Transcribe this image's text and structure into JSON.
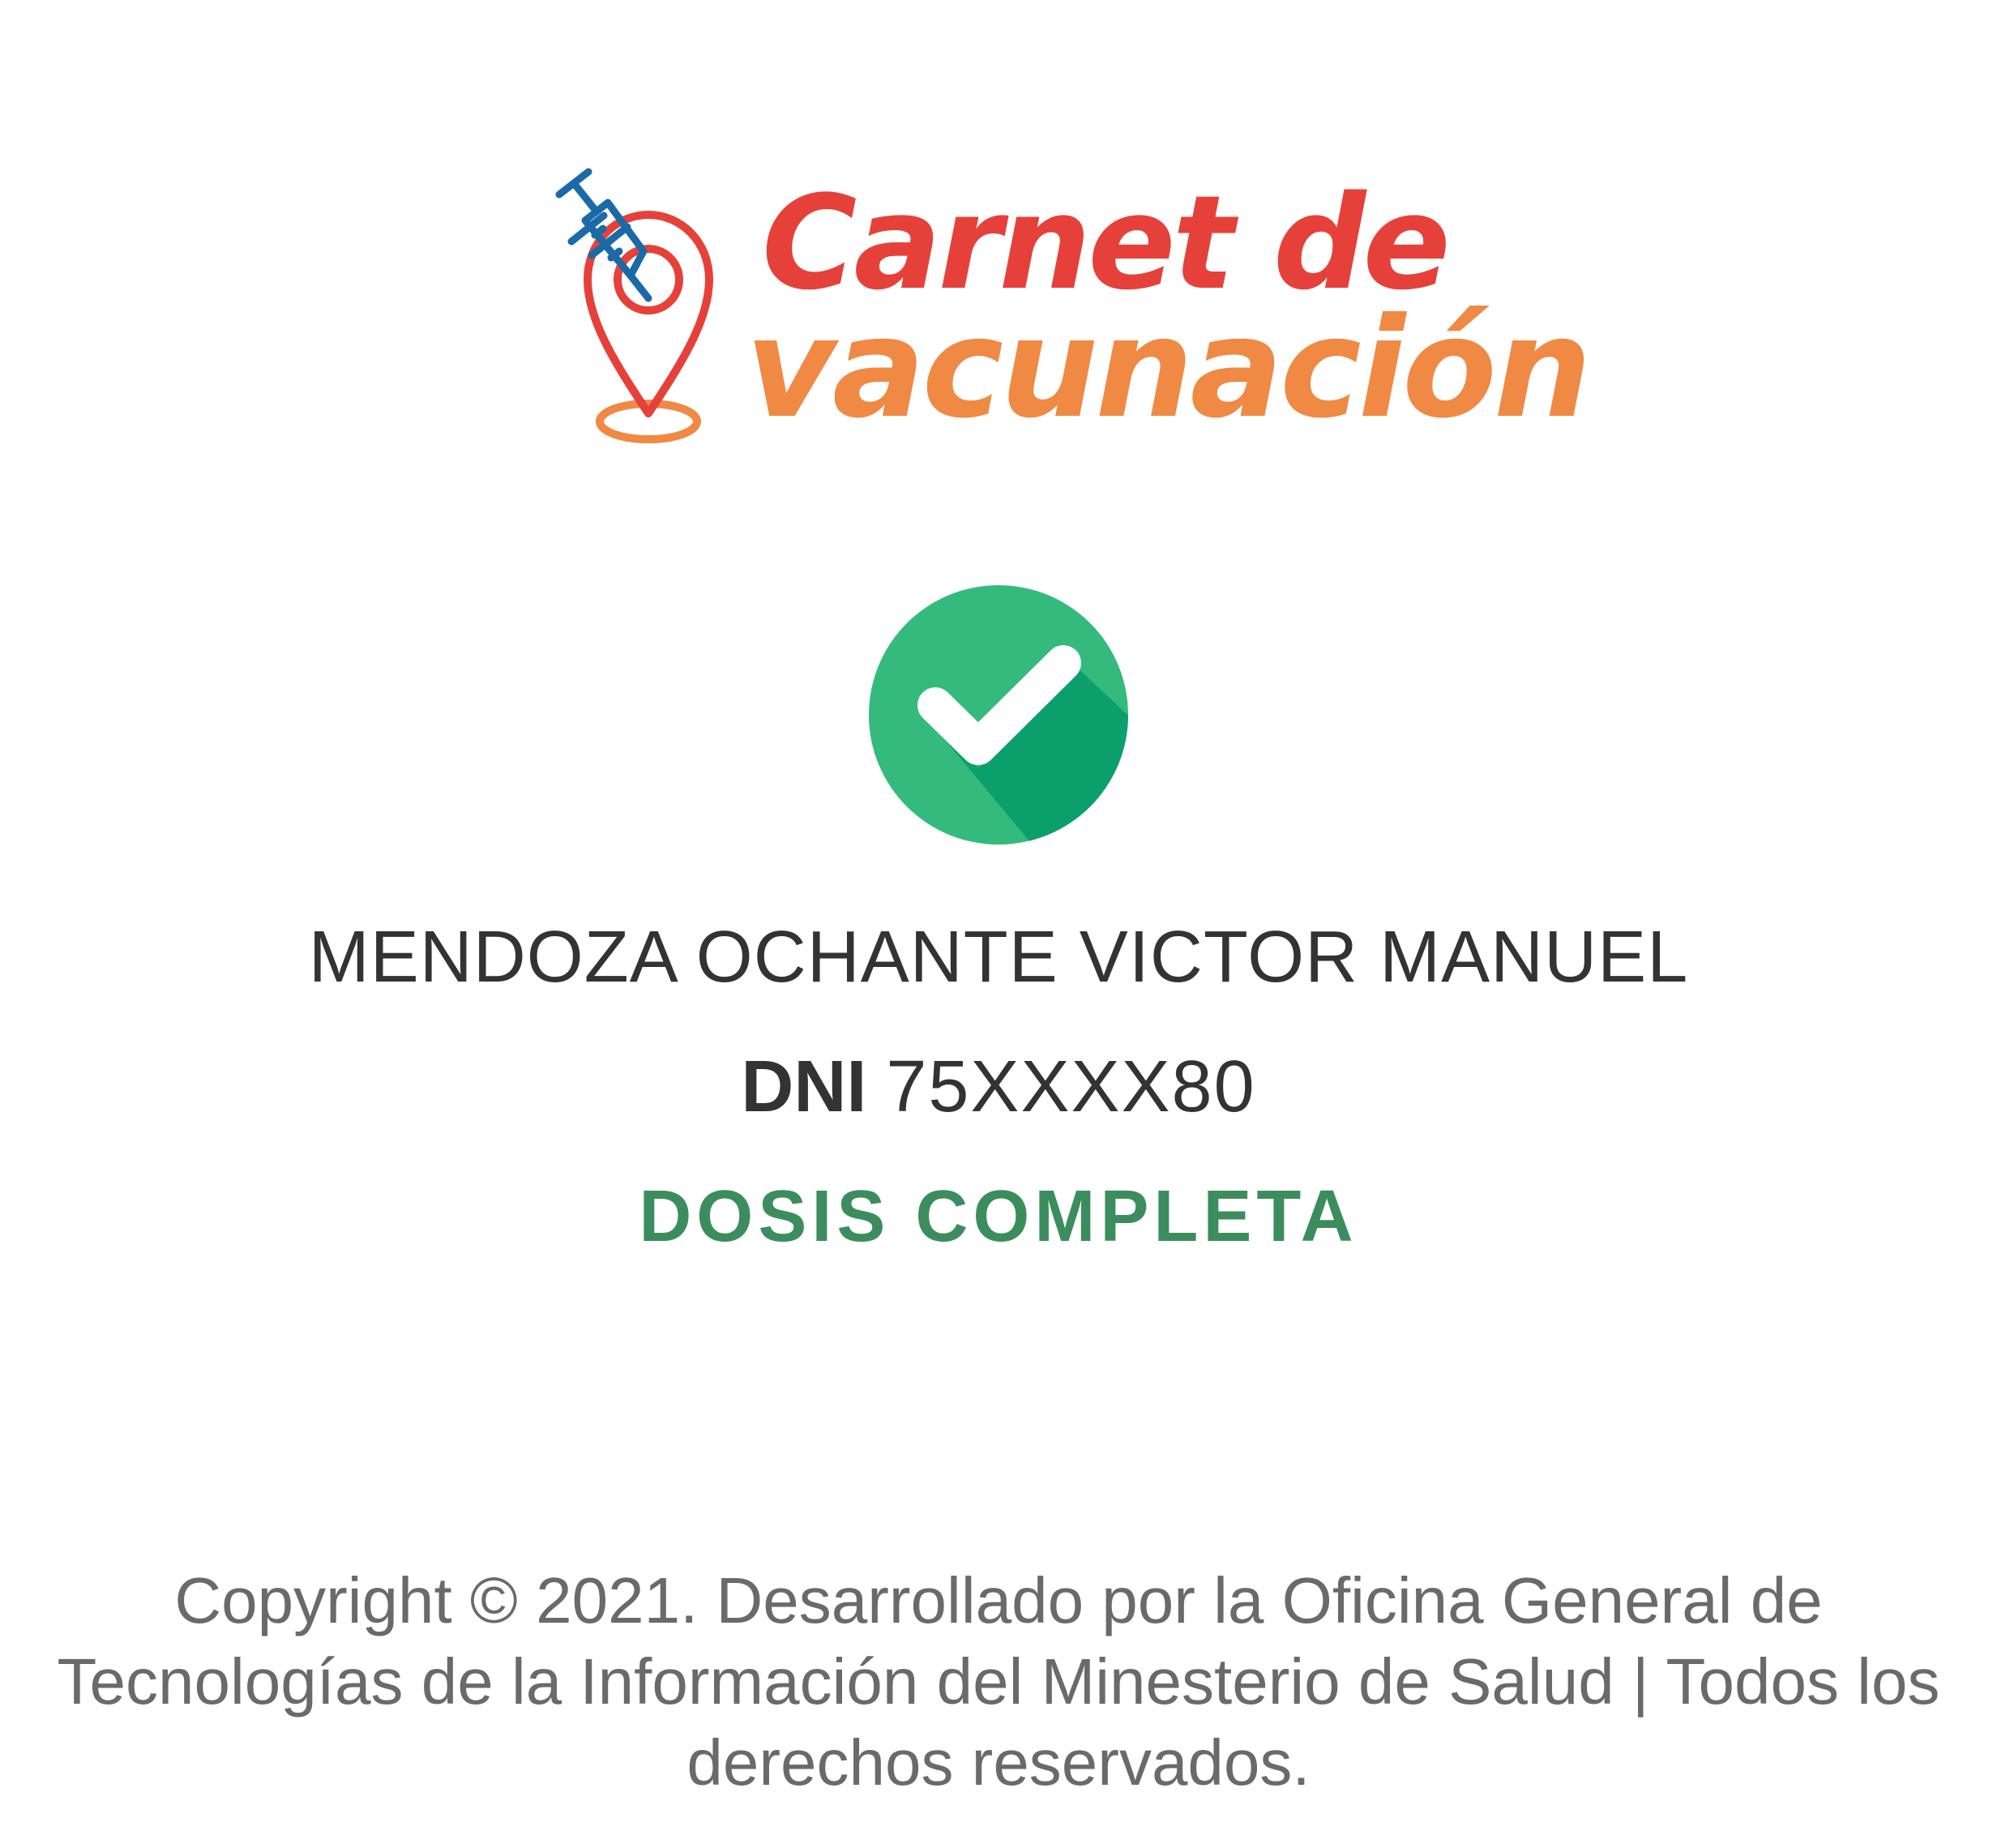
{
  "logo": {
    "line1": "Carnet de",
    "line2": "vacunación",
    "icon": "syringe-location-pin-icon",
    "colors": {
      "red": "#e5413a",
      "orange": "#ef8944",
      "blue": "#1a6aa8"
    }
  },
  "status_icon": {
    "icon": "check-circle-icon",
    "colors": {
      "circle": "#35ba7d",
      "shadow": "#0ba06b",
      "check": "#ffffff"
    }
  },
  "person": {
    "name": "MENDOZA OCHANTE VICTOR MANUEL",
    "dni_label": "DNI",
    "dni_value": "75XXXX80"
  },
  "vaccination": {
    "status": "DOSIS COMPLETA",
    "status_color": "#3c8d5e"
  },
  "footer": {
    "line1": "Copyright © 2021. Desarrollado por la Oficina General de",
    "line2": "Tecnologías de la Información del Minesterio de Salud | Todos los",
    "line3": "derechos reservados."
  }
}
